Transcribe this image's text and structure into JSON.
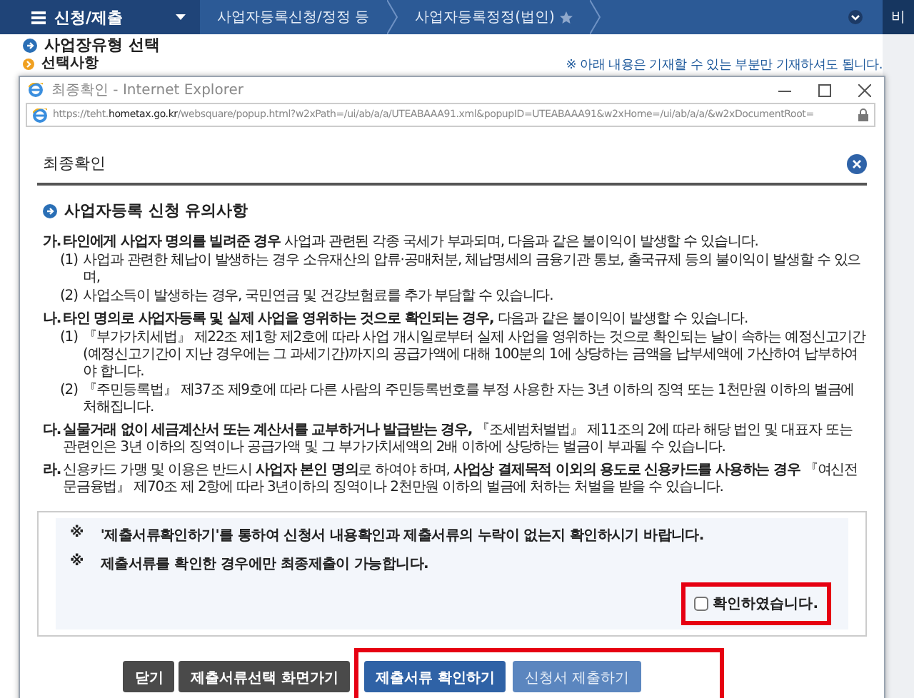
{
  "nav": {
    "menu": "신청/제출",
    "crumbs": [
      {
        "label": "사업자등록신청/정정 등",
        "star": false
      },
      {
        "label": "사업자등록정정(법인)",
        "star": true
      }
    ],
    "side": "비"
  },
  "background": {
    "heading": "사업장유형 선택",
    "subheading": "선택사항",
    "note": "※ 아래 내용은 기재할 수 있는 부분만 기재하셔도 됩니다."
  },
  "popup": {
    "title": "최종확인 - Internet Explorer",
    "url": "https://teht.**hometax.go.kr**/websquare/popup.html?w2xPath=/ui/ab/a/a/UTEABAAA91.xml&popupID=UTEABAAA91&w2xHome=/ui/ab/a/a/&w2xDocumentRoot=",
    "heading": "최종확인",
    "section": "사업자등록 신청 유의사항",
    "items": [
      {
        "lead": "가.",
        "text": "**타인에게 사업자 명의를 빌려준 경우** 사업과 관련된 각종 국세가 부과되며, 다음과 같은 불이익이 발생할 수 있습니다.",
        "subs": [
          {
            "lead": "(1)",
            "text": "사업과 관련한 체납이 발생하는 경우 소유재산의 압류·공매처분, 체납명세의 금융기관 통보, 출국규제 등의 불이익이 발생할 수 있으며,"
          },
          {
            "lead": "(2)",
            "text": "사업소득이 발생하는 경우, 국민연금 및 건강보험료를 추가 부담할 수 있습니다."
          }
        ]
      },
      {
        "lead": "나.",
        "text": "**타인 명의로 사업자등록 및 실제 사업을 영위하는 것으로 확인되는 경우,** 다음과 같은 불이익이 발생할 수 있습니다.",
        "subs": [
          {
            "lead": "(1)",
            "text": "『부가가치세법』 제22조 제1항 제2호에 따라 사업 개시일로부터 실제 사업을 영위하는 것으로 확인되는 날이 속하는 예정신고기간(예정신고기간이 지난 경우에는 그 과세기간)까지의 공급가액에 대해 100분의 1에 상당하는 금액을 납부세액에 가산하여 납부하여야 합니다."
          },
          {
            "lead": "(2)",
            "text": "『주민등록법』 제37조 제9호에 따라 다른 사람의 주민등록번호를 부정 사용한 자는 3년 이하의 징역 또는 1천만원 이하의 벌금에 처해집니다."
          }
        ]
      },
      {
        "lead": "다.",
        "text": "**실물거래 없이 세금계산서 또는 계산서를 교부하거나 발급받는 경우,** 『조세범처벌법』 제11조의 2에 따라 해당 법인 및 대표자 또는 관련인은 3년 이하의 징역이나 공급가액 및 그 부가가치세액의 2배 이하에 상당하는 벌금이 부과될 수 있습니다."
      },
      {
        "lead": "라.",
        "text": "신용카드 가맹 및 이용은 반드시 **사업자 본인 명의**로 하여야 하며, **사업상 결제목적 이외의 용도로 신용카드를 사용하는 경우** 『여신전문금융법』 제70조 제 2항에 따라 3년이하의 징역이나 2천만원 이하의 벌금에 처하는 처벌을 받을 수 있습니다."
      }
    ],
    "notices": [
      {
        "mark": "※",
        "text": "'제출서류확인하기'를 통하여 신청서 내용확인과 제출서류의 누락이 없는지 확인하시기 바랍니다."
      },
      {
        "mark": "※",
        "text": "제출서류를 확인한 경우에만 최종제출이 가능합니다."
      }
    ],
    "confirm": {
      "label": "확인하였습니다.",
      "checked": false,
      "highlighted": true
    },
    "buttons": [
      {
        "label": "닫기",
        "kind": "dark",
        "highlighted": false
      },
      {
        "label": "제출서류선택 화면가기",
        "kind": "dark",
        "highlighted": false
      },
      {
        "label": "제출서류 확인하기",
        "kind": "primary",
        "highlighted": true
      },
      {
        "label": "신청서 제출하기",
        "kind": "muted",
        "highlighted": true
      }
    ]
  }
}
